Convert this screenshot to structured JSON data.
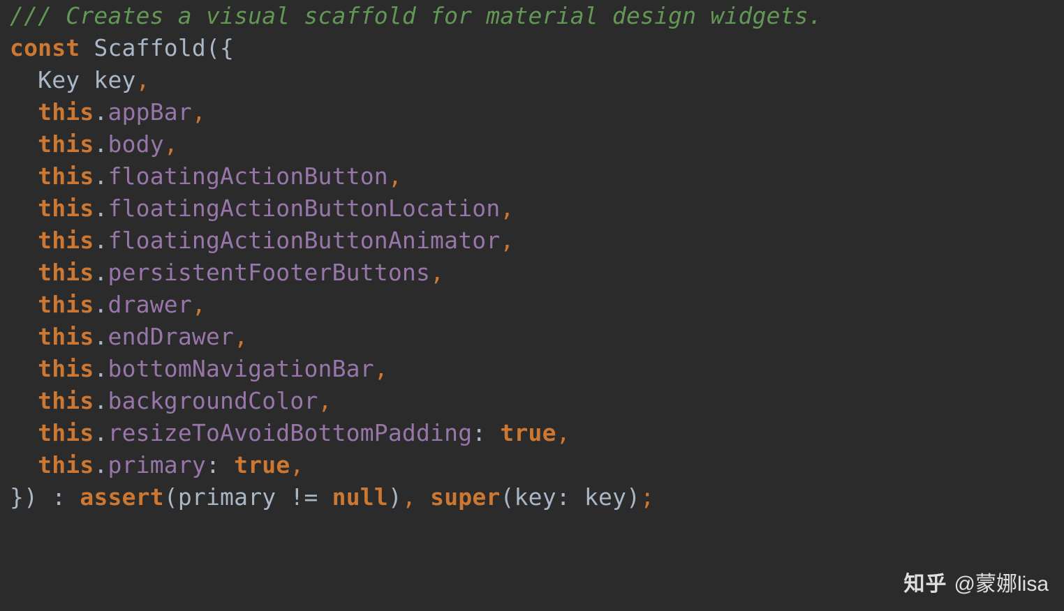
{
  "code": {
    "comment": "/// Creates a visual scaffold for material design widgets.",
    "kw_const": "const",
    "class_name": "Scaffold",
    "open": "({",
    "param_key_type": "Key",
    "param_key_name": "key",
    "kw_this": "this",
    "dot": ".",
    "comma": ",",
    "colon": ":",
    "fields": {
      "appBar": "appBar",
      "body": "body",
      "floatingActionButton": "floatingActionButton",
      "floatingActionButtonLocation": "floatingActionButtonLocation",
      "floatingActionButtonAnimator": "floatingActionButtonAnimator",
      "persistentFooterButtons": "persistentFooterButtons",
      "drawer": "drawer",
      "endDrawer": "endDrawer",
      "bottomNavigationBar": "bottomNavigationBar",
      "backgroundColor": "backgroundColor",
      "resizeToAvoidBottomPadding": "resizeToAvoidBottomPadding",
      "primary": "primary"
    },
    "kw_true": "true",
    "close_brace": "})",
    "kw_assert": "assert",
    "assert_arg": "primary",
    "op_neq": "!=",
    "kw_null": "null",
    "kw_super": "super",
    "super_key_name": "key",
    "super_key_arg": "key",
    "semicolon": ";"
  },
  "watermark": {
    "logo": "知乎",
    "at": "@蒙娜lisa"
  }
}
